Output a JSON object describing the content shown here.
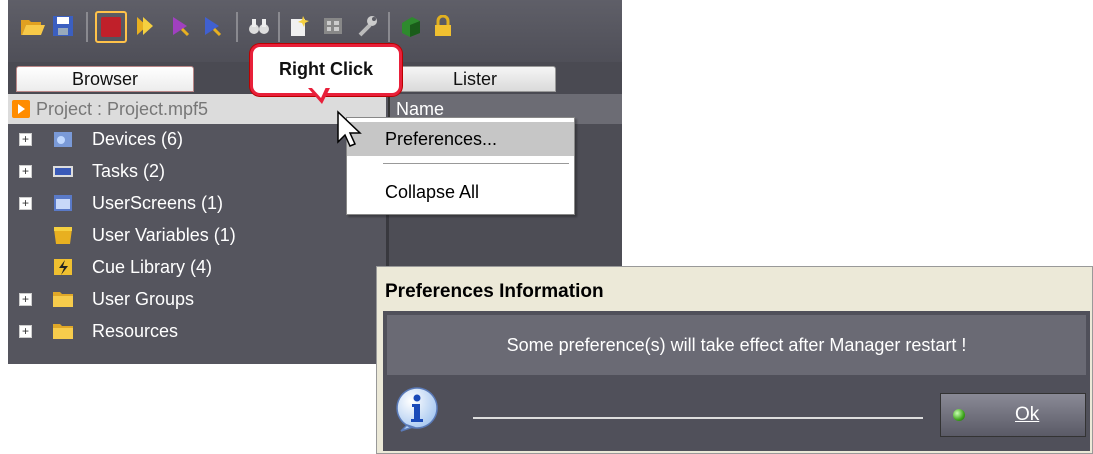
{
  "tabs": {
    "browser": "Browser",
    "lister": "Lister"
  },
  "callout": {
    "text": "Right Click"
  },
  "project": {
    "label": "Project : Project.mpf5"
  },
  "list_header": {
    "name": "Name"
  },
  "tree": {
    "items": [
      {
        "label": "Devices (6)",
        "expandable": true,
        "icon": "devices-icon"
      },
      {
        "label": "Tasks (2)",
        "expandable": true,
        "icon": "tasks-icon"
      },
      {
        "label": "UserScreens (1)",
        "expandable": true,
        "icon": "userscreens-icon"
      },
      {
        "label": "User Variables (1)",
        "expandable": false,
        "icon": "user-variables-icon"
      },
      {
        "label": "Cue Library (4)",
        "expandable": false,
        "icon": "cue-library-icon"
      },
      {
        "label": "User Groups",
        "expandable": true,
        "icon": "folder-icon"
      },
      {
        "label": "Resources",
        "expandable": true,
        "icon": "folder-icon"
      }
    ]
  },
  "context_menu": {
    "items": [
      {
        "label": "Preferences..."
      },
      {
        "label": "Collapse All"
      }
    ]
  },
  "dialog": {
    "title": "Preferences Information",
    "message": "Some preference(s) will take effect after Manager restart !",
    "ok_label": "Ok",
    "icon": "info-icon"
  },
  "colors": {
    "accent_orange": "#ff8c00",
    "callout_red": "#e8203a",
    "panel_bg": "#55555e"
  }
}
